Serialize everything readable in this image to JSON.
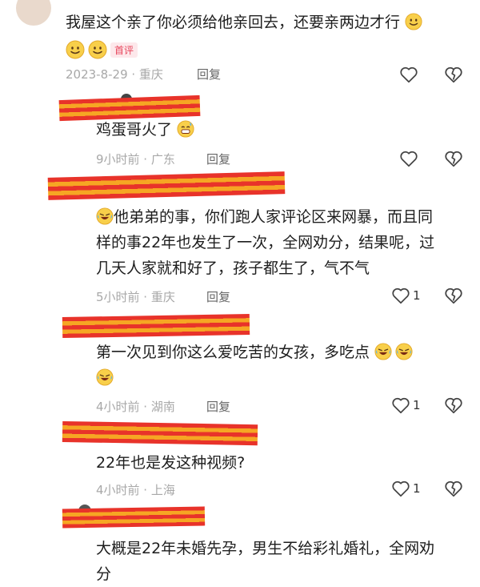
{
  "comments": [
    {
      "text": "我屋这个亲了你必须给他亲回去，还要亲两边才行",
      "tag": "首评",
      "meta": "2023-8-29 · 重庆",
      "reply": "回复",
      "likes": ""
    },
    {
      "text": "鸡蛋哥火了",
      "meta": "9小时前 · 广东",
      "reply": "回复",
      "likes": ""
    },
    {
      "text_line1": "他弟弟的事，你们跑人家评论区来网暴，而且同",
      "text_line2": "样的事22年也发生了一次，全网劝分，结果呢，过",
      "text_line3": "几天人家就和好了，孩子都生了，气不气",
      "meta": "5小时前 · 重庆",
      "reply": "回复",
      "likes": "1"
    },
    {
      "text_line1": "第一次见到你这么爱吃苦的女孩，多吃点",
      "meta": "4小时前 · 湖南",
      "reply": "回复",
      "likes": "1"
    },
    {
      "text": "22年也是发这种视频?",
      "meta": "4小时前 · 上海",
      "reply": "回复",
      "likes": "1"
    },
    {
      "text_line1": "大概是22年未婚先孕，男生不给彩礼婚礼，全网劝",
      "text_line2": "分"
    }
  ],
  "colors": {
    "redaction_red": "#e8332a",
    "redaction_orange": "#f6a623",
    "emoji_yellow": "#f7c948"
  },
  "icons": [
    "heart-icon",
    "broken-heart-icon",
    "smile-emoji-icon",
    "laugh-cry-emoji-icon",
    "grin-sweat-emoji-icon"
  ]
}
